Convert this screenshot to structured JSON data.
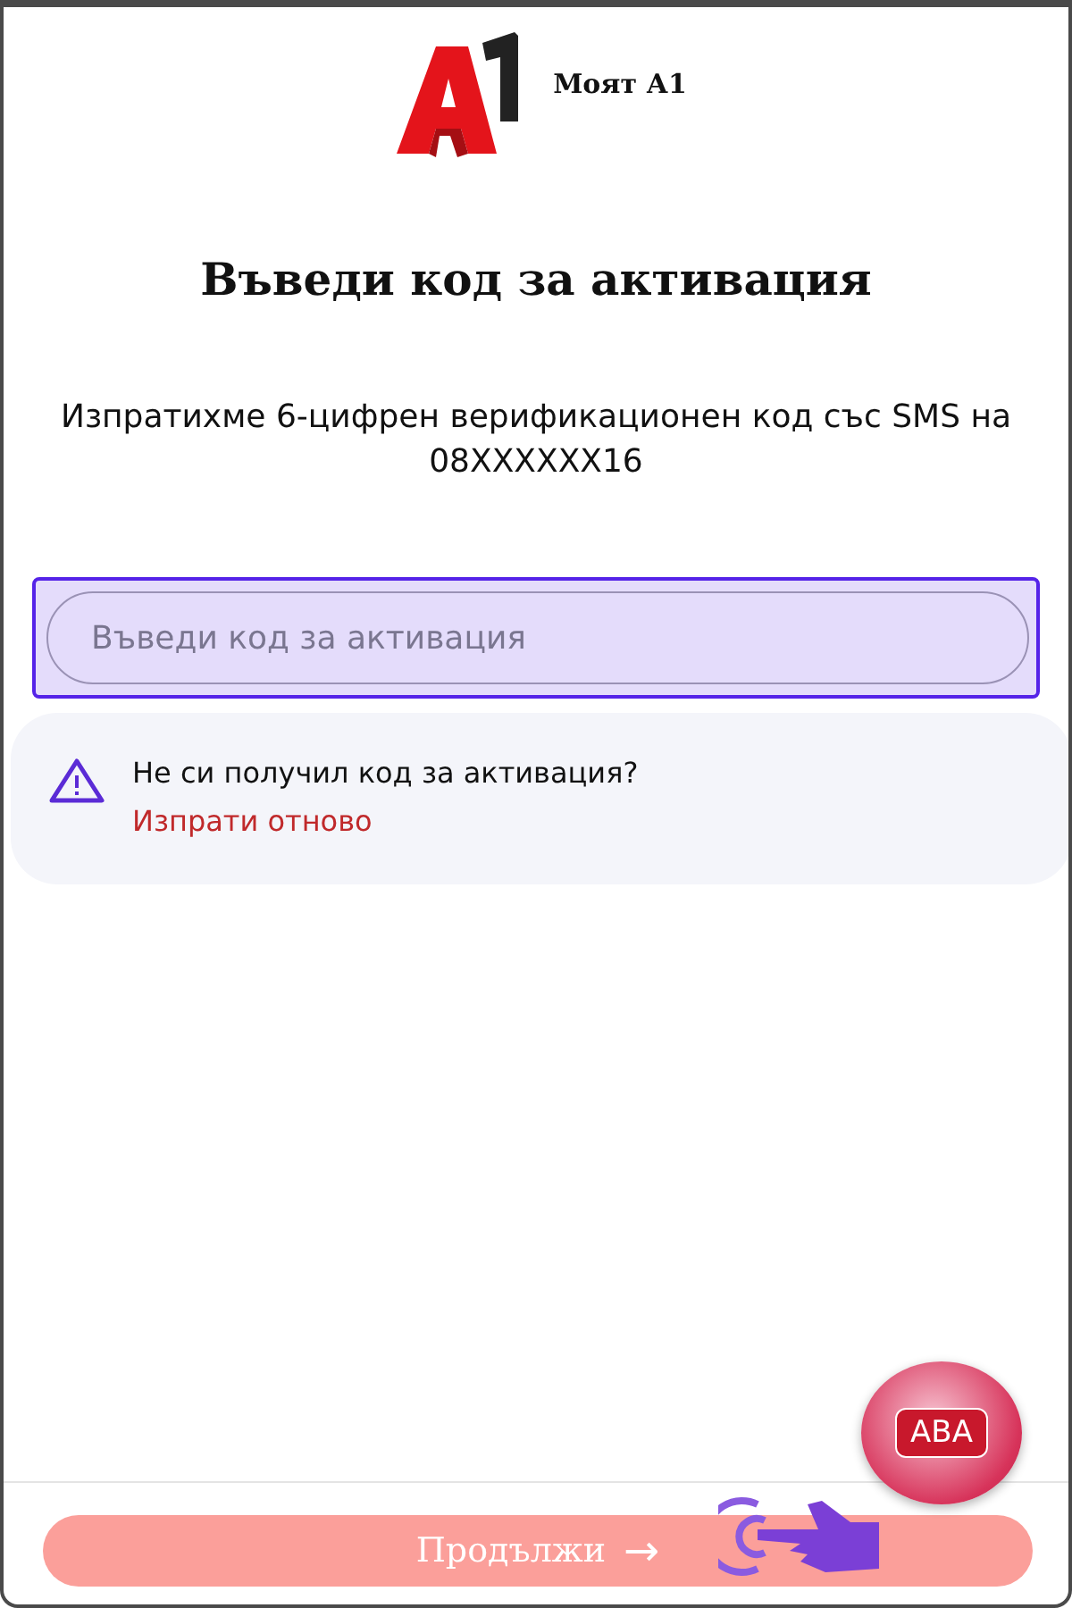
{
  "header": {
    "brand": "Моят А1"
  },
  "title": "Въведи код за активация",
  "subtitle": "Изпратихме 6-цифрен верификационен код със SMS на 08XXXXXX16",
  "code_field": {
    "placeholder": "Въведи код за активация",
    "focused": true
  },
  "notice": {
    "message": "Не си получил код за активация?",
    "link": "Изпрати отново"
  },
  "chat_badge": {
    "label": "ABA"
  },
  "continue_button": {
    "label": "Продължи",
    "arrow": "→",
    "disabled": true
  }
}
